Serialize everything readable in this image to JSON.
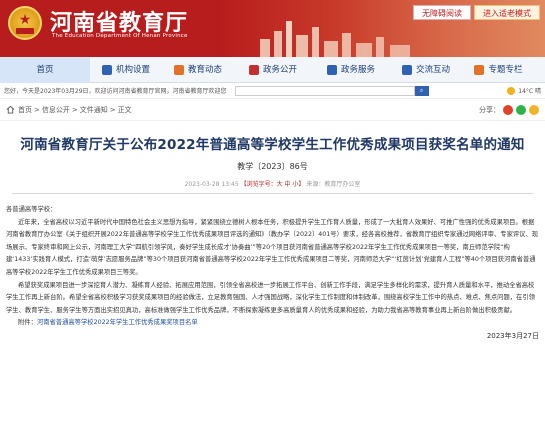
{
  "header": {
    "site_title": "河南省教育厅",
    "site_subtitle": "The Education Department Of Henan Province",
    "accessibility_btn": "无障碍阅读",
    "elder_btn": "进入适老模式"
  },
  "nav": {
    "items": [
      {
        "label": "首页",
        "icon": "home"
      },
      {
        "label": "机构设置",
        "icon": "building-icon"
      },
      {
        "label": "教育动态",
        "icon": "news-icon"
      },
      {
        "label": "政务公开",
        "icon": "doc-icon"
      },
      {
        "label": "政务服务",
        "icon": "service-icon"
      },
      {
        "label": "交流互动",
        "icon": "chat-icon"
      },
      {
        "label": "专题专栏",
        "icon": "topic-icon"
      }
    ]
  },
  "infobar": {
    "date_text": "您好，今天是2023年03月29日，欢迎访问河南省教育厅官网，河南省教育厅欢迎您",
    "weather": "14°C 晴"
  },
  "breadcrumb": {
    "items": [
      "首页",
      "信息公开",
      "文件通知",
      "正文"
    ],
    "share_label": "分享："
  },
  "article": {
    "title": "河南省教育厅关于公布2022年普通高等学校学生工作优秀成果项目获奖名单的通知",
    "doc_number": "教学〔2023〕86号",
    "meta_date": "2023-03-28 13:45",
    "meta_font_prefix": "【浏览字号：",
    "meta_font_sizes": "大 中 小",
    "meta_font_suffix": "】",
    "meta_source": "来源：教育厅办公室",
    "salutation": "各普通高等学校：",
    "para1": "近年来，全省高校以习近平新时代中国特色社会主义思想为指导，紧紧围绕立德树人根本任务，积极提升学生工作育人质量，形成了一大批育人效果好、可推广性强的优秀成果项目。根据河南省教育厅办公室《关于组织开展2022年普通高等学校学生工作优秀成果项目评选的通知》（教办学〔2022〕401号）要求，经各高校推荐，省教育厅组织专家通过网络评审、专家评议、现场展示、专家终审和网上公示，河南理工大学“四航引领学风，奏好学生成长成才‘协奏曲’”等20个项目获河南省普通高等学校2022年学生工作优秀成果项目一等奖，南丘师范学院“构建‘1433’实践育人模式，打造‘萌芽’志愿服务品牌”等30个项目获河南省普通高等学校2022年学生工作优秀成果项目二等奖，河南师范大学“‘红茵计划’党建育人工程”等40个项目获河南省普通高等学校2022年学生工作优秀成果项目三等奖。",
    "para2": "希望获奖成果项目进一步深挖育人潜力、凝练育人经验、拓展应用范围，引领全省高校进一步拓展工作平台、创新工作手段，满足学生多样化的需求，提升育人质量和水平，推动全省高校学生工作再上新台阶。希望全省高校积极学习获奖成果项目的经验做法，立足教育强国、人才强国战略，深化学生工作制度和体制改革，围绕高校学生工作中的热点、难点、焦点问题，在引领学生、教育学生、服务学生等方面出实招见真功，高标准做强学生工作优秀品牌，不断探索凝练更多高质量育人的优秀成果和经验，为助力我省高等教育事业再上新台阶做出积极贡献。",
    "attachment_prefix": "附件：",
    "attachment_link": "河南省普通高等学校2022年学生工作优秀成果奖项目名单",
    "sign_date": "2023年3月27日"
  },
  "colors": {
    "header_red": "#b81d1d",
    "title_blue": "#1f3866",
    "nav_bg": "#f2f5f9",
    "nav_active": "#d6e6f8"
  }
}
